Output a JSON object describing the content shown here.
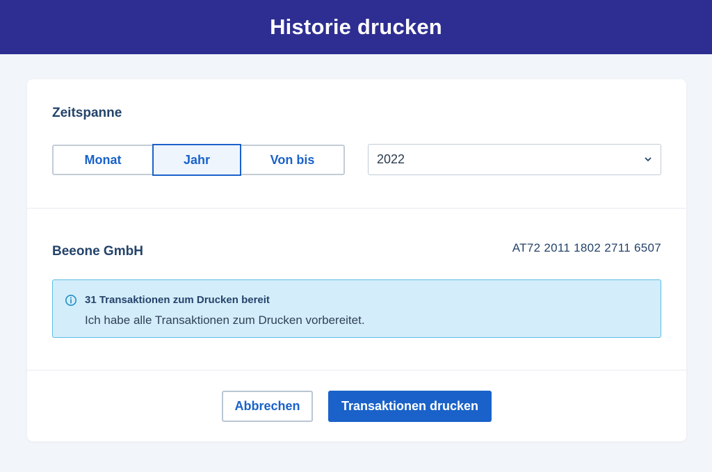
{
  "header": {
    "title": "Historie drucken"
  },
  "period": {
    "label": "Zeitspanne",
    "tabs": [
      {
        "label": "Monat",
        "selected": false
      },
      {
        "label": "Jahr",
        "selected": true
      },
      {
        "label": "Von bis",
        "selected": false
      }
    ],
    "year_select": {
      "value": "2022"
    }
  },
  "account": {
    "name": "Beeone GmbH",
    "iban": "AT72 2011 1802 2711 6507"
  },
  "alert": {
    "title": "31 Transaktionen zum Drucken bereit",
    "text": "Ich habe alle Transaktionen zum Drucken vorbereitet.",
    "icon": "info-icon",
    "color": "#d4edfb"
  },
  "actions": {
    "cancel_label": "Abbrechen",
    "print_label": "Transaktionen drucken"
  },
  "colors": {
    "header_bg": "#2e2e92",
    "accent": "#1a62c9",
    "page_bg": "#f2f5f9"
  }
}
